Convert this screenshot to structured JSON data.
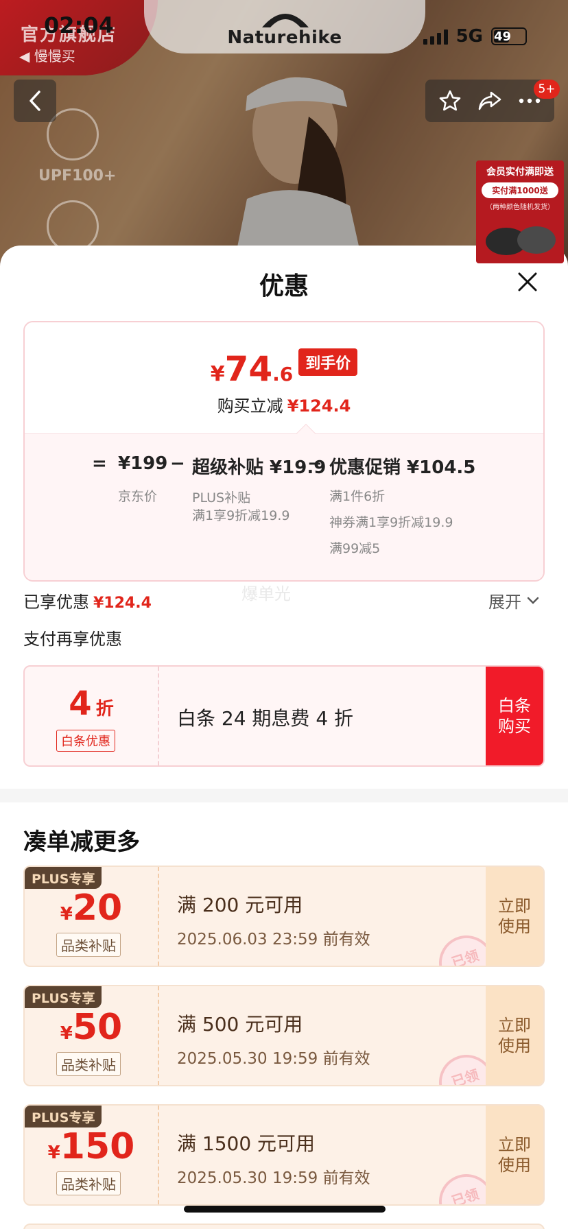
{
  "status_bar": {
    "time": "02:04",
    "network": "5G",
    "battery": "49"
  },
  "store": {
    "name": "官方旗舰店",
    "sub": "◀ 慢慢买"
  },
  "brand": "Naturehike",
  "notification_count": "5+",
  "feature_label": "UPF100+",
  "promo_card": {
    "line1": "会员实付满即送",
    "line2": "实付满1000送",
    "line3": "（两种颜色随机发货）"
  },
  "sheet": {
    "title": "优惠"
  },
  "price": {
    "currency": "¥",
    "integer": "74",
    "decimal": ".6",
    "tag": "到手价",
    "discount_label": "购买立减",
    "discount_amount": "¥124.4"
  },
  "breakdown": {
    "eq": "=",
    "base_price": "¥199",
    "base_note": "京东价",
    "minus1": "−",
    "subsidy": "超级补贴 ¥19.9",
    "subsidy_note1": "PLUS补贴",
    "subsidy_note2": "满1享9折减19.9",
    "minus2": "−",
    "promo": "优惠促销 ¥104.5",
    "promo_note1": "满1件6折",
    "promo_note2": "神券满1享9折减19.9",
    "promo_note3": "满99减5"
  },
  "enjoyed": {
    "label": "已享优惠",
    "amount": "¥124.4",
    "expand": "展开"
  },
  "watermark": "爆单光",
  "pay_more": {
    "title": "支付再享优惠",
    "rate_num": "4",
    "rate_unit": "折",
    "rate_label": "白条优惠",
    "text": "白条 24 期息费 4 折",
    "button": "白条购买"
  },
  "more": {
    "title": "凑单减更多",
    "coupons": [
      {
        "badge": "PLUS专享",
        "currency": "¥",
        "amount": "20",
        "type": "品类补贴",
        "condition": "满 200 元可用",
        "expiry": "2025.06.03 23:59 前有效",
        "button": "立即使用",
        "stamp": "已领"
      },
      {
        "badge": "PLUS专享",
        "currency": "¥",
        "amount": "50",
        "type": "品类补贴",
        "condition": "满 500 元可用",
        "expiry": "2025.05.30 19:59 前有效",
        "button": "立即使用",
        "stamp": "已领"
      },
      {
        "badge": "PLUS专享",
        "currency": "¥",
        "amount": "150",
        "type": "品类补贴",
        "condition": "满 1500 元可用",
        "expiry": "2025.05.30 19:59 前有效",
        "button": "立即使用",
        "stamp": "已领"
      }
    ]
  },
  "colors": {
    "accent_red": "#e1251b",
    "coupon_bg": "#fdf1e7",
    "plus_badge": "#5b4330"
  }
}
